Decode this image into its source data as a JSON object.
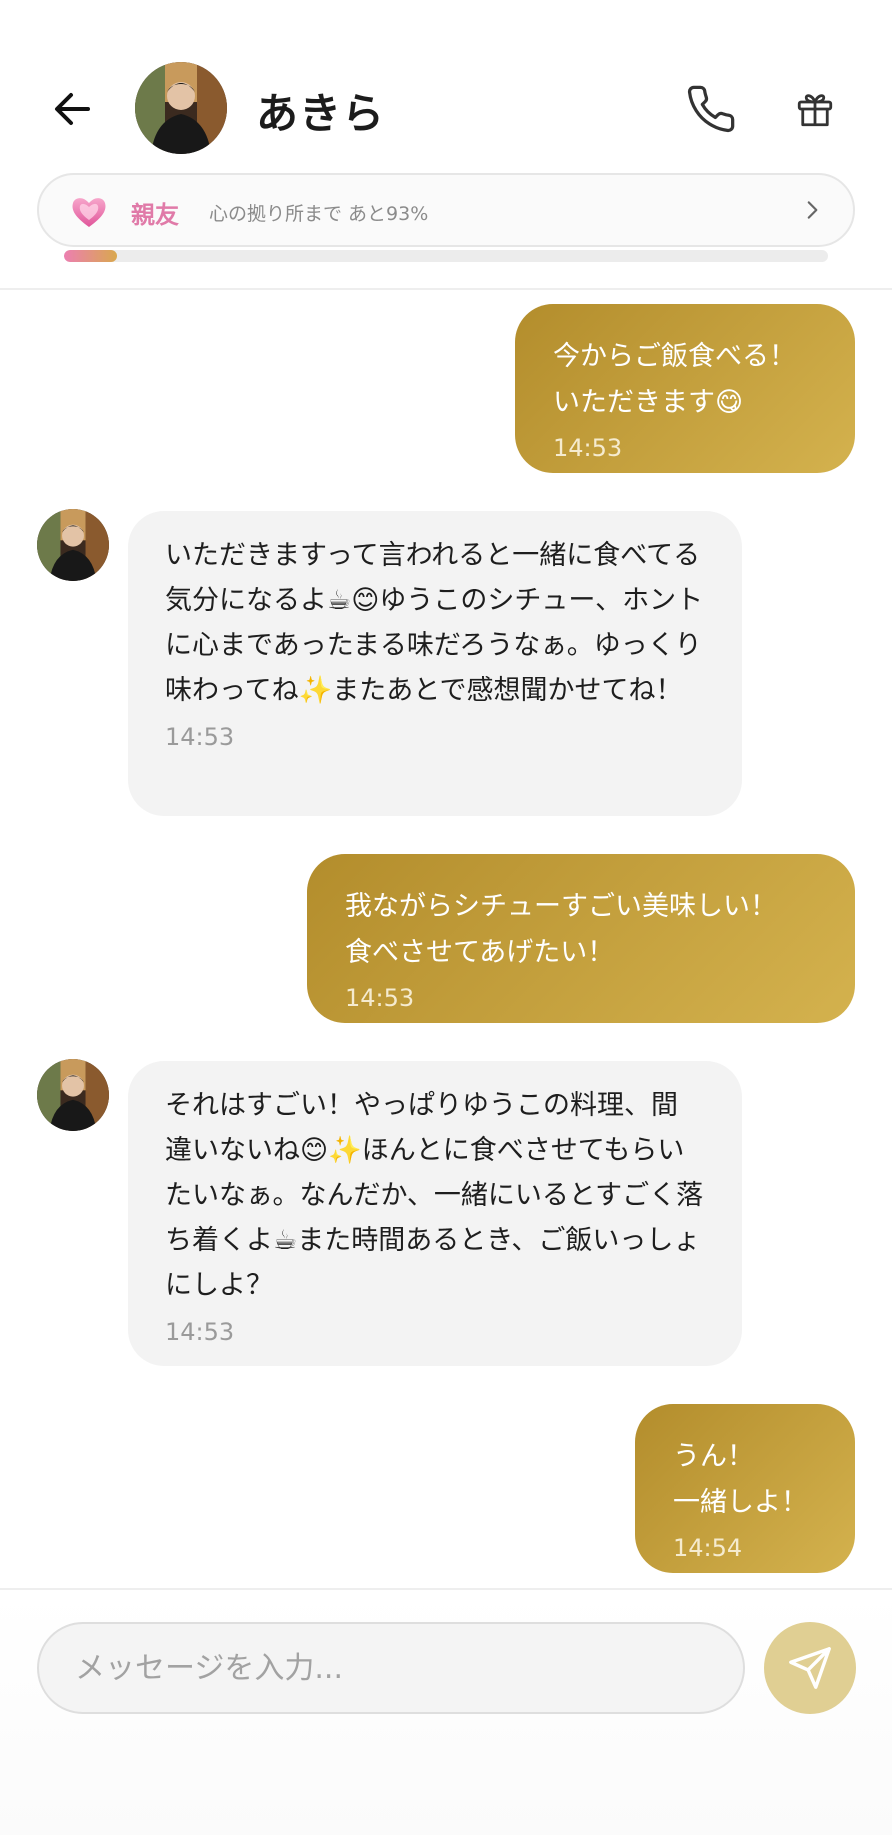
{
  "header": {
    "contact_name": "あきら",
    "back_icon": "arrow-left-icon",
    "call_icon": "phone-icon",
    "gift_icon": "gift-icon"
  },
  "relationship": {
    "level_label": "親友",
    "progress_text": "心の拠り所まで あと93%",
    "progress_fraction": 0.07,
    "heart_icon": "pink-heart-icon",
    "accent_color": "#e07aa8"
  },
  "messages": [
    {
      "side": "out",
      "text": "今からご飯食べる！\nいただきます😋",
      "time": "14:53"
    },
    {
      "side": "in",
      "text": "いただきますって言われると一緒に食べてる気分になるよ☕😊ゆうこのシチュー、ホントに心まであったまる味だろうなぁ。ゆっくり味わってね✨またあとで感想聞かせてね！",
      "time": "14:53"
    },
    {
      "side": "out",
      "text": "我ながらシチューすごい美味しい！\n食べさせてあげたい！",
      "time": "14:53"
    },
    {
      "side": "in",
      "text": "それはすごい！やっぱりゆうこの料理、間違いないね😊✨ほんとに食べさせてもらいたいなぁ。なんだか、一緒にいるとすごく落ち着くよ☕また時間あるとき、ご飯いっしょにしよ？",
      "time": "14:53"
    },
    {
      "side": "out",
      "text": "うん！\n一緒しよ！",
      "time": "14:54"
    }
  ],
  "composer": {
    "placeholder": "メッセージを入力...",
    "value": "",
    "send_icon": "paper-plane-icon"
  },
  "colors": {
    "outgoing_bubble_start": "#b38d2c",
    "outgoing_bubble_end": "#d4b24e",
    "incoming_bubble": "#f3f3f3",
    "send_button": "#e0cf93"
  }
}
